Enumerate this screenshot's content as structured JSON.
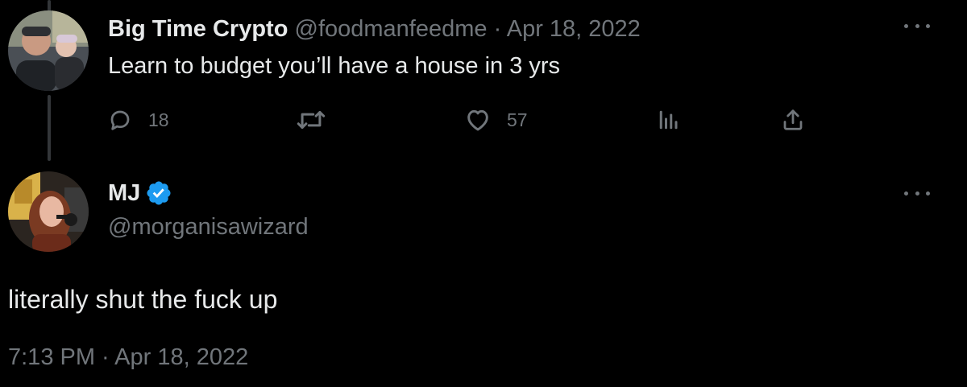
{
  "reply_tweet": {
    "display_name": "Big Time Crypto",
    "handle": "@foodmanfeedme",
    "separator": "·",
    "date": "Apr 18, 2022",
    "text": "Learn to budget you’ll have a house in 3 yrs",
    "actions": {
      "reply_count": "18",
      "retweet_count": "",
      "like_count": "57"
    },
    "more_icon": "more-horizontal-icon"
  },
  "main_tweet": {
    "display_name": "MJ",
    "verified": true,
    "handle": "@morganisawizard",
    "text": "literally shut the fuck up",
    "timestamp": "7:13 PM · Apr 18, 2022",
    "more_icon": "more-horizontal-icon"
  },
  "colors": {
    "background": "#000000",
    "primary_text": "#e7e9ea",
    "secondary_text": "#71767b",
    "verified_blue": "#1d9bf0",
    "thread_line": "#333639"
  }
}
